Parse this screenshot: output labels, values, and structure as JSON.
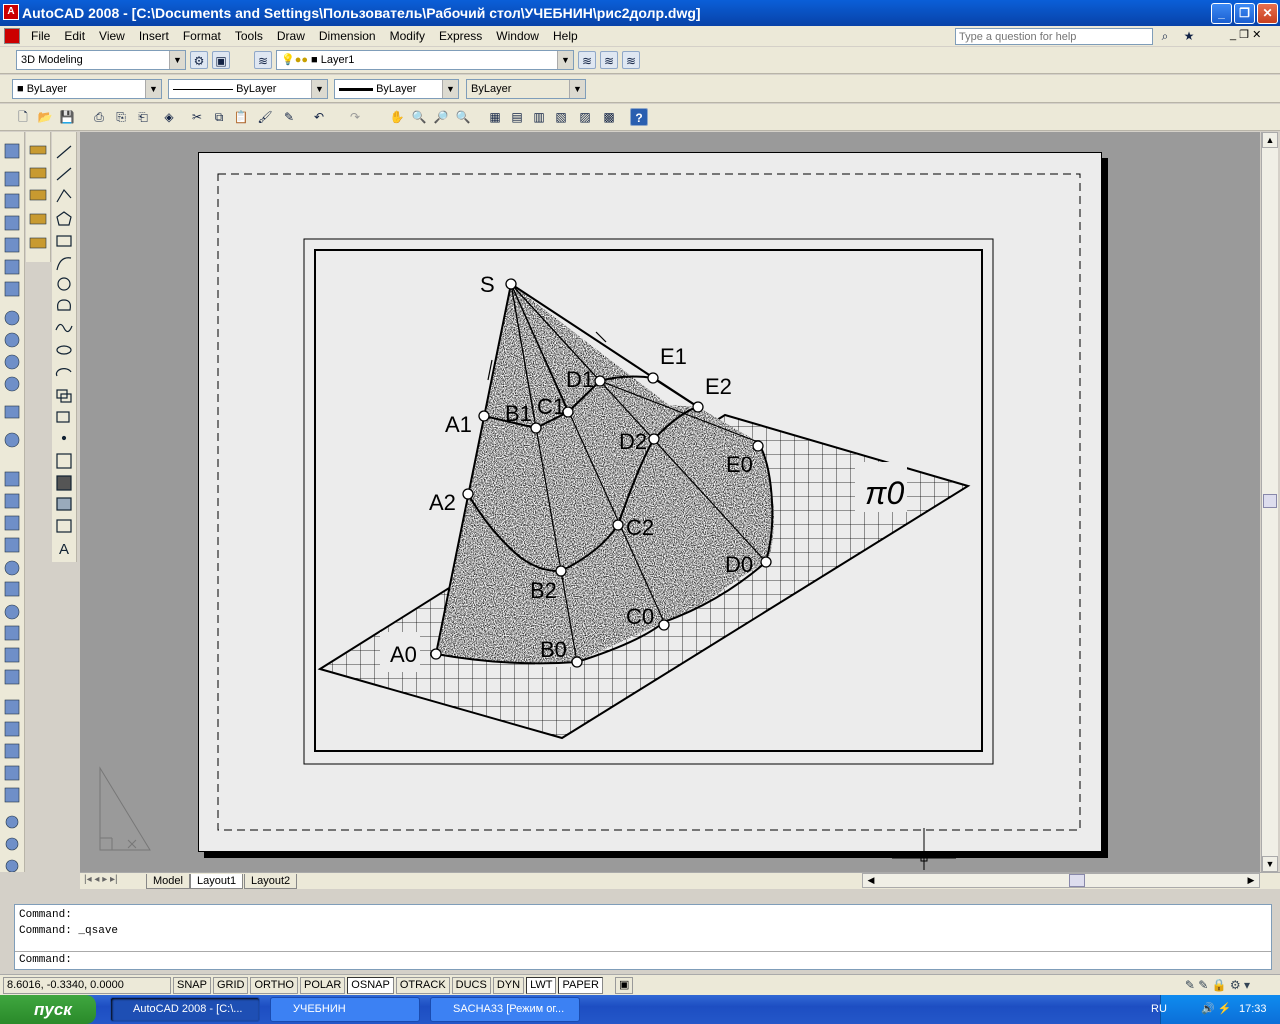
{
  "window": {
    "title": "AutoCAD 2008 - [C:\\Documents and Settings\\Пользователь\\Рабочий стол\\УЧЕБНИН\\рис2долр.dwg]",
    "min": "_",
    "max": "❐",
    "close": "✕"
  },
  "menu": [
    "File",
    "Edit",
    "View",
    "Insert",
    "Format",
    "Tools",
    "Draw",
    "Dimension",
    "Modify",
    "Express",
    "Window",
    "Help"
  ],
  "help": {
    "placeholder": "Type a question for help"
  },
  "toolbar1": {
    "workspace": "3D Modeling",
    "layer": "Layer1"
  },
  "toolbar2": {
    "color": "ByLayer",
    "linetype": "ByLayer",
    "lineweight": "ByLayer",
    "plotstyle": "ByLayer"
  },
  "drawing": {
    "labels": {
      "S": "S",
      "A1": "A1",
      "B1": "B1",
      "C1": "C1",
      "D1": "D1",
      "E1": "E1",
      "E2": "E2",
      "D2": "D2",
      "E0": "E0",
      "A2": "A2",
      "C2": "C2",
      "B2": "B2",
      "D0": "D0",
      "C0": "C0",
      "A0": "A0",
      "B0": "B0",
      "pi": "π0"
    }
  },
  "tabs": [
    "Model",
    "Layout1",
    "Layout2"
  ],
  "command": {
    "lines": [
      "Command:",
      "Command:  _qsave"
    ],
    "prompt": "Command:"
  },
  "status": {
    "coords": "8.6016, -0.3340, 0.0000",
    "buttons": [
      "SNAP",
      "GRID",
      "ORTHO",
      "POLAR",
      "OSNAP",
      "OTRACK",
      "DUCS",
      "DYN",
      "LWT",
      "PAPER"
    ],
    "on": [
      "OSNAP",
      "LWT",
      "PAPER"
    ]
  },
  "taskbar": {
    "start": "пуск",
    "tasks": [
      "AutoCAD 2008 - [C:\\...",
      "УЧЕБНИН",
      "SACHA33 [Режим ог..."
    ],
    "lang": "RU",
    "time": "17:33"
  }
}
